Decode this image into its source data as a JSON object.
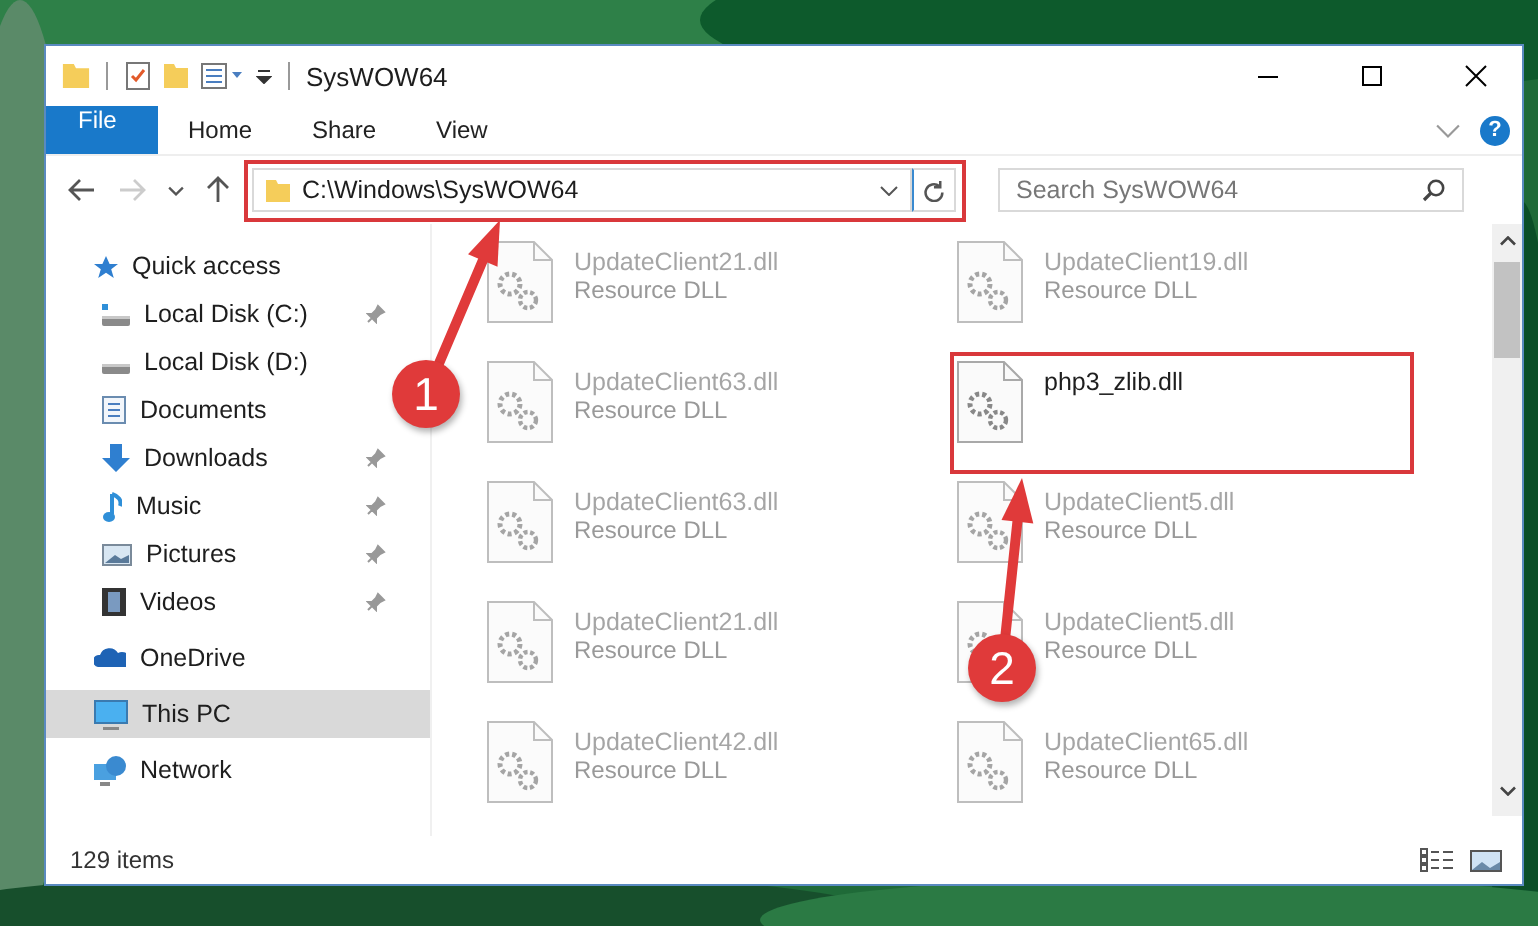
{
  "window": {
    "title": "SysWOW64"
  },
  "ribbon": {
    "tabs": [
      {
        "label": "File",
        "kind": "file",
        "selected": false
      },
      {
        "label": "Home",
        "kind": "tab",
        "selected": false
      },
      {
        "label": "Share",
        "kind": "tab",
        "selected": false
      },
      {
        "label": "View",
        "kind": "tab",
        "selected": false
      }
    ],
    "help": "?"
  },
  "navigation": {
    "forward_disabled": true
  },
  "address_bar": {
    "path": "C:\\Windows\\SysWOW64"
  },
  "search": {
    "placeholder": "Search SysWOW64"
  },
  "sidebar": {
    "items": [
      {
        "label": "Quick access",
        "selected": false,
        "children": [
          {
            "label": "Local Disk (C:)",
            "pinned": true,
            "selected": false
          },
          {
            "label": "Local Disk (D:)",
            "pinned": false,
            "selected": false
          },
          {
            "label": "Documents",
            "pinned": false,
            "selected": false
          },
          {
            "label": "Downloads",
            "pinned": true,
            "selected": false
          },
          {
            "label": "Music",
            "pinned": true,
            "selected": false
          },
          {
            "label": "Pictures",
            "pinned": true,
            "selected": false
          },
          {
            "label": "Videos",
            "pinned": true,
            "selected": false
          }
        ]
      },
      {
        "label": "OneDrive",
        "selected": false
      },
      {
        "label": "This PC",
        "selected": true
      },
      {
        "label": "Network",
        "selected": false
      }
    ]
  },
  "files": [
    {
      "name": "UpdateClient21.dll",
      "type": "Resource DLL",
      "kind": "dimmed"
    },
    {
      "name": "UpdateClient19.dll",
      "type": "Resource DLL",
      "kind": "dimmed"
    },
    {
      "name": "UpdateClient63.dll",
      "type": "Resource DLL",
      "kind": "dimmed"
    },
    {
      "name": "php3_zlib.dll",
      "kind": "highlighted"
    },
    {
      "name": "UpdateClient63.dll",
      "type": "Resource DLL",
      "kind": "dimmed"
    },
    {
      "name": "UpdateClient5.dll",
      "type": "Resource DLL",
      "kind": "dimmed"
    },
    {
      "name": "UpdateClient21.dll",
      "type": "Resource DLL",
      "kind": "dimmed"
    },
    {
      "name": "UpdateClient5.dll",
      "type": "Resource DLL",
      "kind": "dimmed"
    },
    {
      "name": "UpdateClient42.dll",
      "type": "Resource DLL",
      "kind": "dimmed"
    },
    {
      "name": "UpdateClient65.dll",
      "type": "Resource DLL",
      "kind": "dimmed"
    }
  ],
  "status_bar": {
    "item_count": "129 items"
  },
  "annotations": [
    {
      "number": "1"
    },
    {
      "number": "2"
    }
  ]
}
